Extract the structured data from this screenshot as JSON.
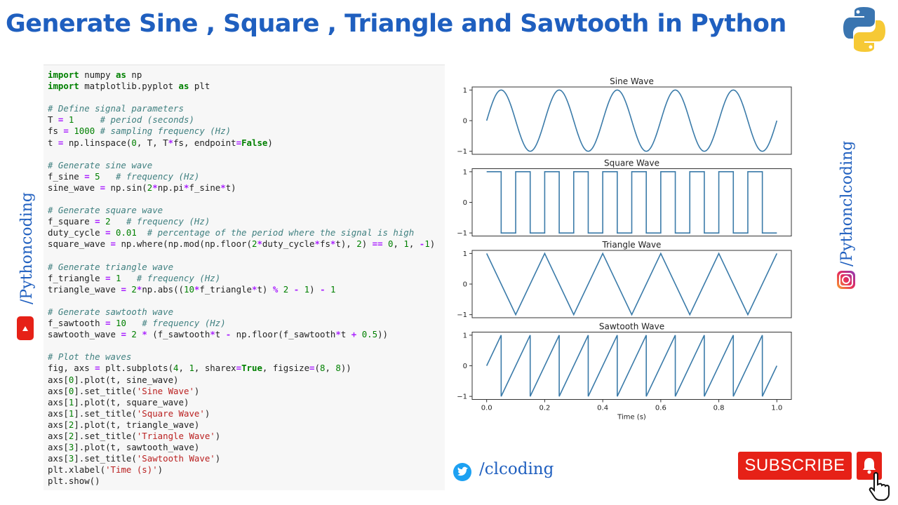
{
  "header": {
    "title": "Generate Sine , Square , Triangle and Sawtooth in Python"
  },
  "social": {
    "left_vertical": "/Pythoncoding",
    "right_vertical": "/Pythonclcoding",
    "twitter_handle": "/clcoding",
    "subscribe_label": "SUBSCRIBE"
  },
  "icons": [
    "python-logo-icon",
    "youtube-icon",
    "instagram-icon",
    "twitter-icon",
    "bell-icon",
    "hand-cursor-icon"
  ],
  "colors": {
    "accent": "#1f5fbf",
    "line": "#3b7ba9",
    "youtube": "#e62117"
  },
  "code_lines": [
    "import numpy as np",
    "import matplotlib.pyplot as plt",
    "",
    "# Define signal parameters",
    "T = 1     # period (seconds)",
    "fs = 1000 # sampling frequency (Hz)",
    "t = np.linspace(0, T, T*fs, endpoint=False)",
    "",
    "# Generate sine wave",
    "f_sine = 5   # frequency (Hz)",
    "sine_wave = np.sin(2*np.pi*f_sine*t)",
    "",
    "# Generate square wave",
    "f_square = 2   # frequency (Hz)",
    "duty_cycle = 0.01  # percentage of the period where the signal is high",
    "square_wave = np.where(np.mod(np.floor(2*duty_cycle*fs*t), 2) == 0, 1, -1)",
    "",
    "# Generate triangle wave",
    "f_triangle = 1   # frequency (Hz)",
    "triangle_wave = 2*np.abs((10*f_triangle*t) % 2 - 1) - 1",
    "",
    "# Generate sawtooth wave",
    "f_sawtooth = 10   # frequency (Hz)",
    "sawtooth_wave = 2 * (f_sawtooth*t - np.floor(f_sawtooth*t + 0.5))",
    "",
    "# Plot the waves",
    "fig, axs = plt.subplots(4, 1, sharex=True, figsize=(8, 8))",
    "axs[0].plot(t, sine_wave)",
    "axs[0].set_title('Sine Wave')",
    "axs[1].plot(t, square_wave)",
    "axs[1].set_title('Square Wave')",
    "axs[2].plot(t, triangle_wave)",
    "axs[2].set_title('Triangle Wave')",
    "axs[3].plot(t, sawtooth_wave)",
    "axs[3].set_title('Sawtooth Wave')",
    "plt.xlabel('Time (s)')",
    "plt.show()"
  ],
  "chart_data": [
    {
      "type": "line",
      "title": "Sine Wave",
      "xlim": [
        0,
        1
      ],
      "ylim": [
        -1,
        1
      ],
      "yticks": [
        "1",
        "0",
        "−1"
      ],
      "series": [
        {
          "x": [
            0,
            0.05,
            0.1,
            0.15,
            0.2,
            0.25,
            0.3,
            0.35,
            0.4,
            0.45,
            0.5,
            0.55,
            0.6,
            0.65,
            0.7,
            0.75,
            0.8,
            0.85,
            0.9,
            0.95,
            1.0
          ],
          "y": [
            0,
            1,
            0,
            -1,
            0,
            1,
            0,
            -1,
            0,
            1,
            0,
            -1,
            0,
            1,
            0,
            -1,
            0,
            1,
            0,
            -1,
            0
          ]
        }
      ]
    },
    {
      "type": "line",
      "title": "Square Wave",
      "xlim": [
        0,
        1
      ],
      "ylim": [
        -1,
        1
      ],
      "yticks": [
        "1",
        "0",
        "−1"
      ],
      "series": [
        {
          "x": [
            0,
            0.05,
            0.05,
            0.1,
            0.1,
            0.15,
            0.15,
            0.2,
            0.2,
            0.25,
            0.25,
            0.3,
            0.3,
            0.35,
            0.35,
            0.4,
            0.4,
            0.45,
            0.45,
            0.5,
            0.5,
            0.55,
            0.55,
            0.6,
            0.6,
            0.65,
            0.65,
            0.7,
            0.7,
            0.75,
            0.75,
            0.8,
            0.8,
            0.85,
            0.85,
            0.9,
            0.9,
            0.95,
            0.95,
            1.0
          ],
          "y": [
            1,
            1,
            -1,
            -1,
            1,
            1,
            -1,
            -1,
            1,
            1,
            -1,
            -1,
            1,
            1,
            -1,
            -1,
            1,
            1,
            -1,
            -1,
            1,
            1,
            -1,
            -1,
            1,
            1,
            -1,
            -1,
            1,
            1,
            -1,
            -1,
            1,
            1,
            -1,
            -1,
            1,
            1,
            -1,
            -1
          ]
        }
      ]
    },
    {
      "type": "line",
      "title": "Triangle Wave",
      "xlim": [
        0,
        1
      ],
      "ylim": [
        -1,
        1
      ],
      "yticks": [
        "1",
        "0",
        "−1"
      ],
      "series": [
        {
          "x": [
            0,
            0.1,
            0.2,
            0.3,
            0.4,
            0.5,
            0.6,
            0.7,
            0.8,
            0.9,
            1.0
          ],
          "y": [
            1,
            -1,
            1,
            -1,
            1,
            -1,
            1,
            -1,
            1,
            -1,
            1
          ]
        }
      ]
    },
    {
      "type": "line",
      "title": "Sawtooth Wave",
      "xlabel": "Time (s)",
      "xlim": [
        0,
        1
      ],
      "ylim": [
        -1,
        1
      ],
      "yticks": [
        "1",
        "0",
        "−1"
      ],
      "xticks": [
        "0.0",
        "0.2",
        "0.4",
        "0.6",
        "0.8",
        "1.0"
      ],
      "series": [
        {
          "x": [
            0,
            0.05,
            0.05,
            0.15,
            0.15,
            0.25,
            0.25,
            0.35,
            0.35,
            0.45,
            0.45,
            0.55,
            0.55,
            0.65,
            0.65,
            0.75,
            0.75,
            0.85,
            0.85,
            0.95,
            0.95,
            1.0
          ],
          "y": [
            0,
            1,
            -1,
            1,
            -1,
            1,
            -1,
            1,
            -1,
            1,
            -1,
            1,
            -1,
            1,
            -1,
            1,
            -1,
            1,
            -1,
            1,
            -1,
            0
          ]
        }
      ]
    }
  ]
}
